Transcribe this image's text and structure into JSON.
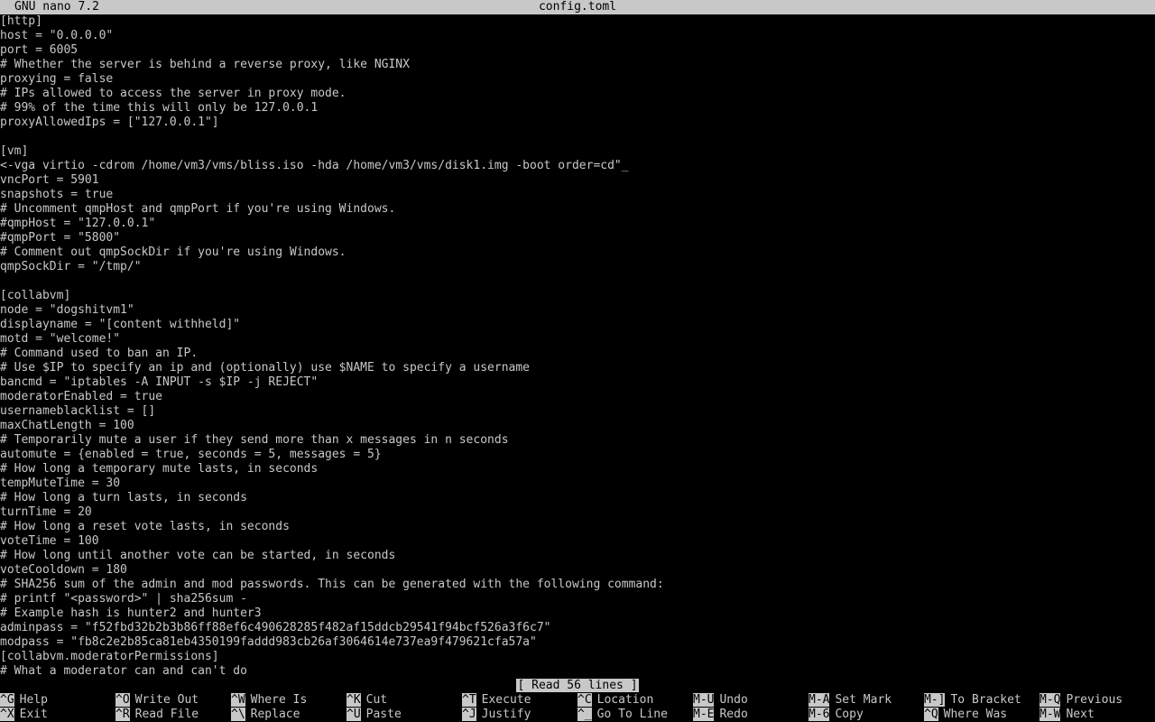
{
  "titlebar": {
    "app": "GNU nano 7.2",
    "file": "config.toml"
  },
  "editor": {
    "lines": [
      "[http]",
      "host = \"0.0.0.0\"",
      "port = 6005",
      "# Whether the server is behind a reverse proxy, like NGINX",
      "proxying = false",
      "# IPs allowed to access the server in proxy mode.",
      "# 99% of the time this will only be 127.0.0.1",
      "proxyAllowedIps = [\"127.0.0.1\"]",
      "",
      "[vm]",
      "<-vga virtio -cdrom /home/vm3/vms/bliss.iso -hda /home/vm3/vms/disk1.img -boot order=cd\"_",
      "vncPort = 5901",
      "snapshots = true",
      "# Uncomment qmpHost and qmpPort if you're using Windows.",
      "#qmpHost = \"127.0.0.1\"",
      "#qmpPort = \"5800\"",
      "# Comment out qmpSockDir if you're using Windows.",
      "qmpSockDir = \"/tmp/\"",
      "",
      "[collabvm]",
      "node = \"dogshitvm1\"",
      "displayname = \"[content withheld]\"",
      "motd = \"welcome!\"",
      "# Command used to ban an IP.",
      "# Use $IP to specify an ip and (optionally) use $NAME to specify a username",
      "bancmd = \"iptables -A INPUT -s $IP -j REJECT\"",
      "moderatorEnabled = true",
      "usernameblacklist = []",
      "maxChatLength = 100",
      "# Temporarily mute a user if they send more than x messages in n seconds",
      "automute = {enabled = true, seconds = 5, messages = 5}",
      "# How long a temporary mute lasts, in seconds",
      "tempMuteTime = 30",
      "# How long a turn lasts, in seconds",
      "turnTime = 20",
      "# How long a reset vote lasts, in seconds",
      "voteTime = 100",
      "# How long until another vote can be started, in seconds",
      "voteCooldown = 180",
      "# SHA256 sum of the admin and mod passwords. This can be generated with the following command:",
      "# printf \"<password>\" | sha256sum -",
      "# Example hash is hunter2 and hunter3",
      "adminpass = \"f52fbd32b2b3b86ff88ef6c490628285f482af15ddcb29541f94bcf526a3f6c7\"",
      "modpass = \"fb8c2e2b85ca81eb4350199faddd983cb26af3064614e737ea9f479621cfa57a\"",
      "[collabvm.moderatorPermissions]",
      "# What a moderator can and can't do"
    ]
  },
  "status": {
    "message": "[ Read 56 lines ]"
  },
  "shortcuts": [
    {
      "key": "^G",
      "label": "Help"
    },
    {
      "key": "^X",
      "label": "Exit"
    },
    {
      "key": "^O",
      "label": "Write Out"
    },
    {
      "key": "^R",
      "label": "Read File"
    },
    {
      "key": "^W",
      "label": "Where Is"
    },
    {
      "key": "^\\",
      "label": "Replace"
    },
    {
      "key": "^K",
      "label": "Cut"
    },
    {
      "key": "^U",
      "label": "Paste"
    },
    {
      "key": "^T",
      "label": "Execute"
    },
    {
      "key": "^J",
      "label": "Justify"
    },
    {
      "key": "^C",
      "label": "Location"
    },
    {
      "key": "^_",
      "label": "Go To Line"
    },
    {
      "key": "M-U",
      "label": "Undo"
    },
    {
      "key": "M-E",
      "label": "Redo"
    },
    {
      "key": "M-A",
      "label": "Set Mark"
    },
    {
      "key": "M-6",
      "label": "Copy"
    },
    {
      "key": "M-]",
      "label": "To Bracket"
    },
    {
      "key": "^Q",
      "label": "Where Was"
    },
    {
      "key": "M-Q",
      "label": "Previous"
    },
    {
      "key": "M-W",
      "label": "Next"
    }
  ],
  "colors": {
    "background": "#000000",
    "foreground": "#c8c8c8",
    "inverse_bg": "#c8c8c8",
    "inverse_fg": "#000000"
  }
}
